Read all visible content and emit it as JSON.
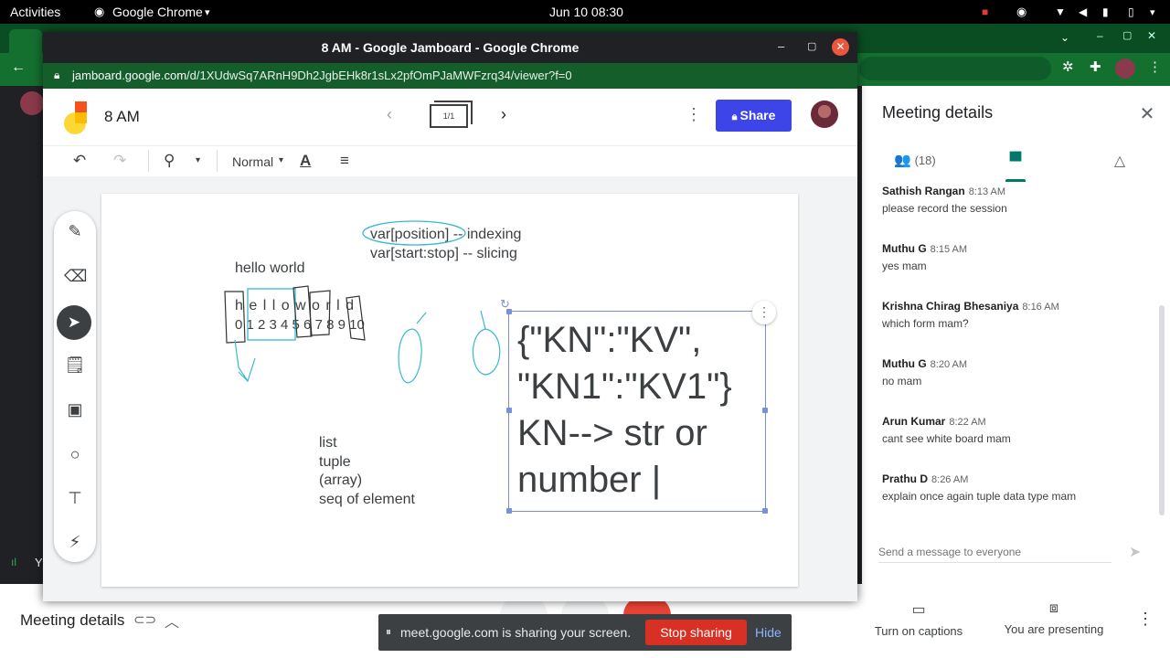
{
  "topbar": {
    "activities": "Activities",
    "app": "Google Chrome",
    "datetime": "Jun 10  08:30"
  },
  "window": {
    "title": "8 AM - Google Jamboard - Google Chrome",
    "url_domain": "jamboard.google.com",
    "url_path": "/d/1XUdwSq7ARnH9Dh2JgbEHk8r1sLx2pfOmPJaMWFzrq34/viewer?f=0"
  },
  "jamboard": {
    "doc_title": "8 AM",
    "frame_indicator": "1/1",
    "share_label": "Share",
    "text_style": "Normal",
    "board_text": {
      "slicing_line1": "var[position] -- indexing",
      "slicing_line2": "var[start:stop] -- slicing",
      "hello": "hello world",
      "hello_spaced": "h e l l o  w o r l d",
      "indices": "0 1 2 3 4 5 6 7 8 9 10",
      "list_items": [
        "list",
        "tuple",
        "(array)",
        "seq of element"
      ],
      "big_text": "{\"KN\":\"KV\",\n\"KN1\":\"KV1\"}\nKN--> str or\nnumber |"
    }
  },
  "meet": {
    "panel_title": "Meeting details",
    "people_count": "(18)",
    "messages": [
      {
        "name": "Sathish Rangan",
        "time": "8:13 AM",
        "text": "please record the session"
      },
      {
        "name": "Muthu G",
        "time": "8:15 AM",
        "text": "yes mam"
      },
      {
        "name": "Krishna Chirag Bhesaniya",
        "time": "8:16 AM",
        "text": "which form mam?"
      },
      {
        "name": "Muthu G",
        "time": "8:20 AM",
        "text": "no mam"
      },
      {
        "name": "Arun Kumar",
        "time": "8:22 AM",
        "text": "cant see white board mam"
      },
      {
        "name": "Prathu D",
        "time": "8:26 AM",
        "text": "explain once again tuple data type mam"
      }
    ],
    "send_placeholder": "Send a message to everyone",
    "bottom": {
      "meeting_details": "Meeting details",
      "captions": "Turn on captions",
      "presenting": "You are presenting"
    },
    "banner": {
      "text": "meet.google.com is sharing your screen.",
      "stop": "Stop sharing",
      "hide": "Hide"
    }
  },
  "colors": {
    "share_blue": "#3d44e8",
    "stop_red": "#d93025",
    "chat_green": "#00796b",
    "ink_cyan": "#3bb8d0"
  }
}
